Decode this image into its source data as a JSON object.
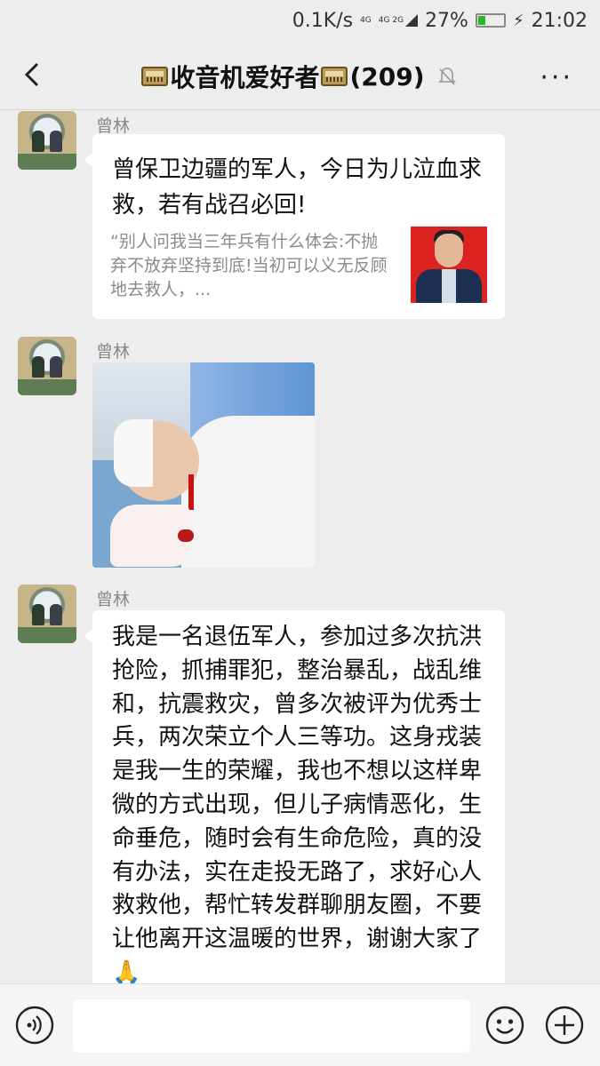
{
  "status_bar": {
    "speed": "0.1K/s",
    "network_1": "4G",
    "network_2": "4G 2G",
    "battery_percent": "27%",
    "battery_level": 0.27,
    "time": "21:02"
  },
  "header": {
    "title": "收音机爱好者",
    "member_count": "(209)",
    "back_icon": "chevron-left-icon",
    "mute_icon": "bell-muted-icon",
    "more_icon": "more-dots-icon",
    "more_label": "···"
  },
  "messages": [
    {
      "sender": "曾林",
      "type": "link",
      "title": "曾保卫边疆的军人，今日为儿泣血求救，若有战召必回!",
      "description": "“别人问我当三年兵有什么体会:不抛弃不放弃坚持到底!当初可以义无反顾地去救人，..."
    },
    {
      "sender": "曾林",
      "type": "image"
    },
    {
      "sender": "曾林",
      "type": "text",
      "text": "我是一名退伍军人，参加过多次抗洪抢险，抓捕罪犯，整治暴乱，战乱维和，抗震救灾，曾多次被评为优秀士兵，两次荣立个人三等功。这身戎装是我一生的荣耀，我也不想以这样卑微的方式出现，但儿子病情恶化，生命垂危，随时会有生命危险，真的没有办法，实在走投无路了，求好心人救救他，帮忙转发群聊朋友圈，不要让他离开这温暖的世界，谢谢大家了🙏"
    }
  ],
  "input_bar": {
    "voice_icon": "voice-icon",
    "emoji_icon": "emoji-icon",
    "add_icon": "plus-icon"
  }
}
